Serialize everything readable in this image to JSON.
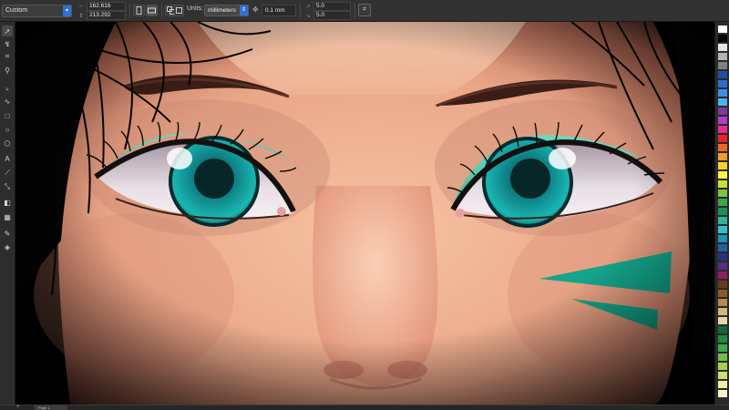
{
  "propertybar": {
    "preset": "Custom",
    "width_value": "162.616",
    "height_value": "213.292",
    "units_label": "Units:",
    "units_value": "millimeters",
    "nudge_value": "0.1 mm",
    "dup_x": "5.0",
    "dup_y": "5.0"
  },
  "toolbox": {
    "tools": [
      "pick-tool-icon",
      "shape-tool-icon",
      "crop-tool-icon",
      "zoom-tool-icon",
      "freehand-tool-icon",
      "artistic-media-icon",
      "rectangle-tool-icon",
      "ellipse-tool-icon",
      "polygon-tool-icon",
      "text-tool-icon",
      "parallel-dimension-icon",
      "connector-tool-icon",
      "drop-shadow-icon",
      "transparency-icon",
      "eyedropper-icon",
      "interactive-fill-icon"
    ]
  },
  "palette": {
    "colors": [
      "#ffffff",
      "#000000",
      "#e6e6e6",
      "#b3b3b3",
      "#808080",
      "#1f4ea0",
      "#2e6ad6",
      "#3c8fe8",
      "#48b3f0",
      "#7d3c98",
      "#b63cc8",
      "#e52c8c",
      "#e8242a",
      "#f0662a",
      "#f39a2a",
      "#f8d030",
      "#fff44a",
      "#c8e03a",
      "#7cc444",
      "#38a64a",
      "#1a8f5a",
      "#2bb59a",
      "#2fc2c9",
      "#1d93b8",
      "#20619e",
      "#2a2f86",
      "#5b2c86",
      "#8c1f5a",
      "#6b3a1f",
      "#8a5a2a",
      "#b58a4a",
      "#d6b47a",
      "#e8d4a8",
      "#0f6a3a",
      "#1f8a3f",
      "#3aa84a",
      "#6cc04a",
      "#a6d24a",
      "#cfe070",
      "#edf0a0",
      "#f4f4c8"
    ]
  },
  "statusbar": {
    "page_tab": "Page 1",
    "add_page": "+"
  }
}
